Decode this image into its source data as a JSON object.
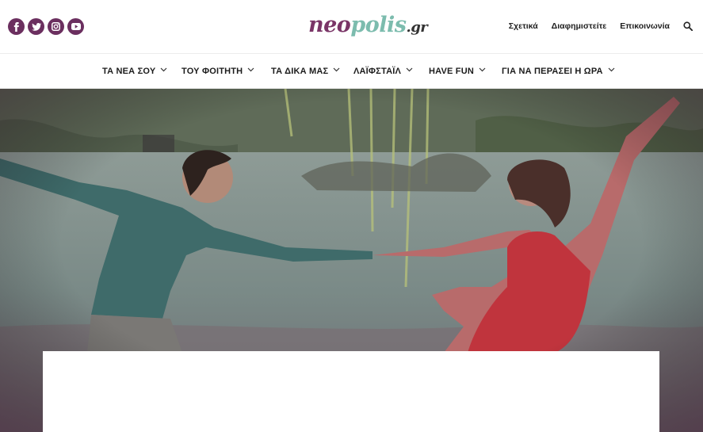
{
  "social": [
    {
      "name": "facebook-icon",
      "glyph": "f"
    },
    {
      "name": "twitter-icon"
    },
    {
      "name": "instagram-icon"
    },
    {
      "name": "youtube-icon"
    }
  ],
  "logo": {
    "part1": "neo",
    "part2": "polis",
    "part3": ".gr"
  },
  "top_links": [
    "Σχετικά",
    "Διαφημιστείτε",
    "Επικοινωνία"
  ],
  "nav": [
    "ΤΑ ΝΕΑ ΣΟΥ",
    "ΤΟΥ ΦΟΙΤΗΤΗ",
    "ΤΑ ΔΙΚΑ ΜΑΣ",
    "ΛΑΪΦΣΤΑΪΛ",
    "HAVE FUN",
    "ΓΙΑ ΝΑ ΠΕΡΑΣΕΙ Η ΩΡΑ"
  ],
  "colors": {
    "brand": "#6b2f5f",
    "logo_accent": "#7cbcae"
  }
}
